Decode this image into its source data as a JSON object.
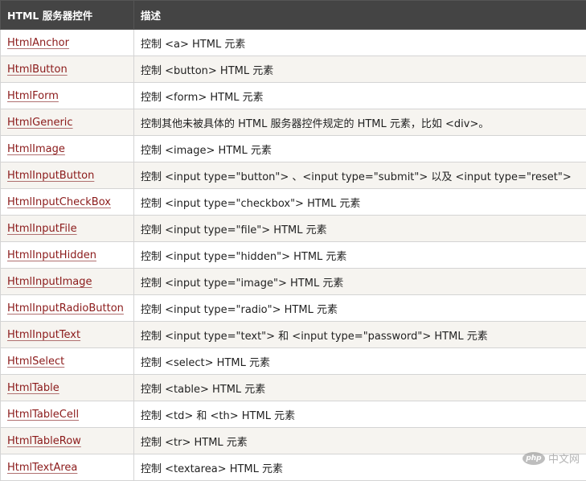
{
  "header": {
    "col1": "HTML 服务器控件",
    "col2": "描述"
  },
  "rows": [
    {
      "name": "HtmlAnchor",
      "desc": "控制 <a> HTML 元素"
    },
    {
      "name": "HtmlButton",
      "desc": "控制 <button> HTML 元素"
    },
    {
      "name": "HtmlForm",
      "desc": "控制 <form> HTML 元素"
    },
    {
      "name": "HtmlGeneric",
      "desc": "控制其他未被具体的 HTML 服务器控件规定的 HTML 元素，比如 <div>。"
    },
    {
      "name": "HtmlImage",
      "desc": "控制 <image> HTML 元素"
    },
    {
      "name": "HtmlInputButton",
      "desc": "控制 <input type=\"button\"> 、<input type=\"submit\"> 以及 <input type=\"reset\">"
    },
    {
      "name": "HtmlInputCheckBox",
      "desc": "控制 <input type=\"checkbox\"> HTML 元素"
    },
    {
      "name": "HtmlInputFile",
      "desc": "控制 <input type=\"file\"> HTML 元素"
    },
    {
      "name": "HtmlInputHidden",
      "desc": "控制 <input type=\"hidden\"> HTML 元素"
    },
    {
      "name": "HtmlInputImage",
      "desc": "控制 <input type=\"image\"> HTML 元素"
    },
    {
      "name": "HtmlInputRadioButton",
      "desc": "控制 <input type=\"radio\"> HTML 元素"
    },
    {
      "name": "HtmlInputText",
      "desc": "控制 <input type=\"text\"> 和 <input type=\"password\"> HTML 元素"
    },
    {
      "name": "HtmlSelect",
      "desc": "控制 <select> HTML 元素"
    },
    {
      "name": "HtmlTable",
      "desc": "控制 <table> HTML 元素"
    },
    {
      "name": "HtmlTableCell",
      "desc": "控制 <td> 和 <th> HTML 元素"
    },
    {
      "name": "HtmlTableRow",
      "desc": "控制 <tr> HTML 元素"
    },
    {
      "name": "HtmlTextArea",
      "desc": "控制 <textarea> HTML 元素"
    }
  ],
  "watermark": {
    "logo": "php",
    "text": "中文网"
  },
  "colors": {
    "header_bg": "#444444",
    "header_text": "#ffffff",
    "link": "#8b1a1a",
    "alt_row_bg": "#f6f4f0",
    "border": "#d4d4d4"
  }
}
